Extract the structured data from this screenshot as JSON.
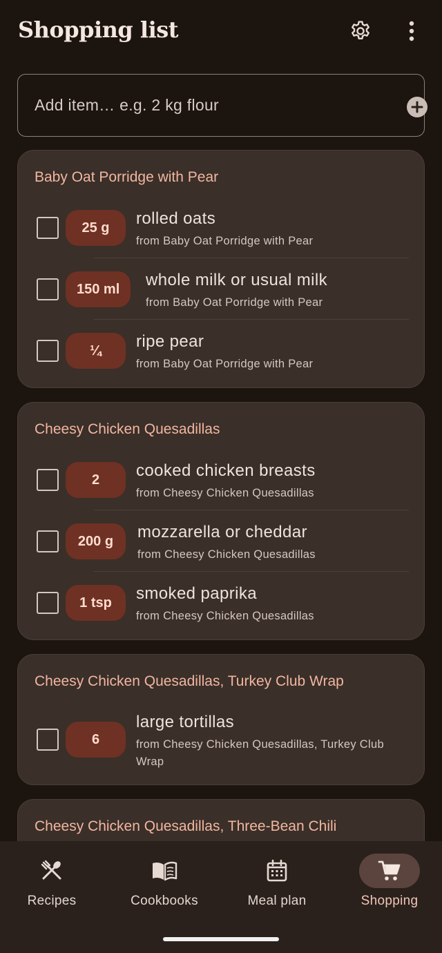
{
  "header": {
    "title": "Shopping list",
    "settings_icon": "gear-icon",
    "more_icon": "more-vert-icon"
  },
  "add_item": {
    "placeholder": "Add item… e.g. 2 kg flour",
    "value": "",
    "add_icon": "add-circle-icon"
  },
  "groups": [
    {
      "title": "Baby Oat Porridge with Pear",
      "items": [
        {
          "qty": "25 g",
          "name": "rolled oats",
          "source": "from Baby Oat Porridge with Pear",
          "checked": false
        },
        {
          "qty": "150 ml",
          "name": "whole milk or usual milk",
          "source": "from Baby Oat Porridge with Pear",
          "checked": false
        },
        {
          "qty": "¼",
          "name": "ripe pear",
          "source": "from Baby Oat Porridge with Pear",
          "checked": false
        }
      ]
    },
    {
      "title": "Cheesy Chicken Quesadillas",
      "items": [
        {
          "qty": "2",
          "name": "cooked chicken breasts",
          "source": "from Cheesy Chicken Quesadillas",
          "checked": false
        },
        {
          "qty": "200 g",
          "name": "mozzarella or cheddar",
          "source": "from Cheesy Chicken Quesadillas",
          "checked": false
        },
        {
          "qty": "1 tsp",
          "name": "smoked paprika",
          "source": "from Cheesy Chicken Quesadillas",
          "checked": false
        }
      ]
    },
    {
      "title": "Cheesy Chicken Quesadillas, Turkey Club Wrap",
      "items": [
        {
          "qty": "6",
          "name": "large tortillas",
          "source_line1": "from Cheesy Chicken Quesadillas, Turkey Club",
          "source_line2": "Wrap",
          "checked": false
        }
      ]
    },
    {
      "title": "Cheesy Chicken Quesadillas, Three-Bean Chili",
      "items": []
    }
  ],
  "nav": {
    "items": [
      {
        "label": "Recipes",
        "icon": "fork-spoon-icon",
        "active": false
      },
      {
        "label": "Cookbooks",
        "icon": "open-book-icon",
        "active": false
      },
      {
        "label": "Meal plan",
        "icon": "calendar-icon",
        "active": false
      },
      {
        "label": "Shopping",
        "icon": "shopping-cart-icon",
        "active": true
      }
    ]
  },
  "colors": {
    "background": "#1c140f",
    "card": "#3a2f29",
    "accent_text": "#f2b6a0",
    "quantity_chip": "#6f3123",
    "nav_active_pill": "#5b443d"
  }
}
